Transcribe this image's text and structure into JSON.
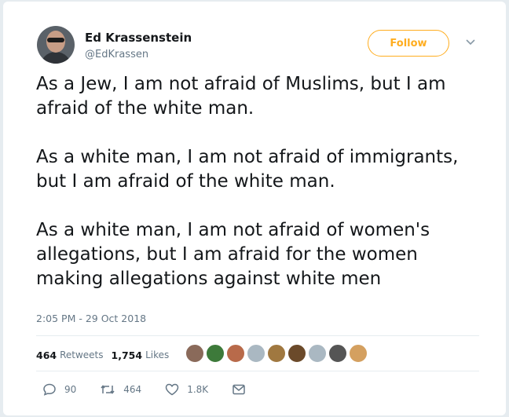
{
  "author": {
    "name": "Ed Krassenstein",
    "handle": "@EdKrassen"
  },
  "follow_label": "Follow",
  "tweet": {
    "paragraphs": [
      "As a Jew, I am not afraid of Muslims, but I am afraid of the white man.",
      "As a white man, I am not afraid of immigrants, but I am afraid of the white man.",
      "As a white man, I am not afraid of women's allegations, but I am afraid for the women making allegations against white men"
    ],
    "timestamp": "2:05 PM - 29 Oct 2018"
  },
  "stats": {
    "retweets_count": "464",
    "retweets_label": "Retweets",
    "likes_count": "1,754",
    "likes_label": "Likes"
  },
  "likers_avatar_colors": [
    "#8a6a5a",
    "#3d7a3a",
    "#b86a4a",
    "#aab8c2",
    "#a07840",
    "#6b4a2a",
    "#aab8c2",
    "#555555",
    "#d4a060"
  ],
  "actions": {
    "replies": "90",
    "retweets": "464",
    "likes": "1.8K"
  },
  "colors": {
    "accent": "#ffad1f",
    "text": "#14171a",
    "secondary": "#657786"
  }
}
